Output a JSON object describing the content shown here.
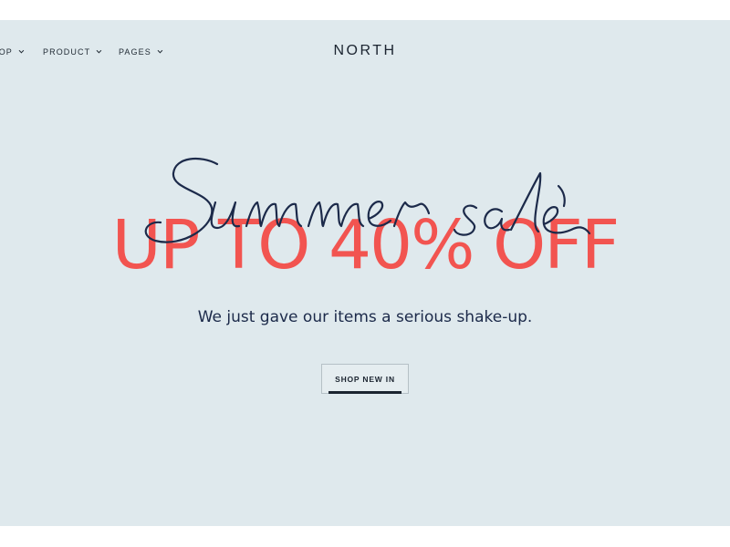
{
  "nav": {
    "items": [
      {
        "label": "SHOP"
      },
      {
        "label": "PRODUCT"
      },
      {
        "label": "PAGES"
      }
    ],
    "logo": "NORTH"
  },
  "hero": {
    "script_text": "Summer sale",
    "headline": "UP TO 40% OFF",
    "subline": "We just gave our items a serious shake-up.",
    "cta_label": "SHOP NEW IN"
  },
  "colors": {
    "background": "#dfe9ed",
    "headline": "#f25450",
    "script": "#1c2a4a",
    "text": "#1b2430"
  }
}
